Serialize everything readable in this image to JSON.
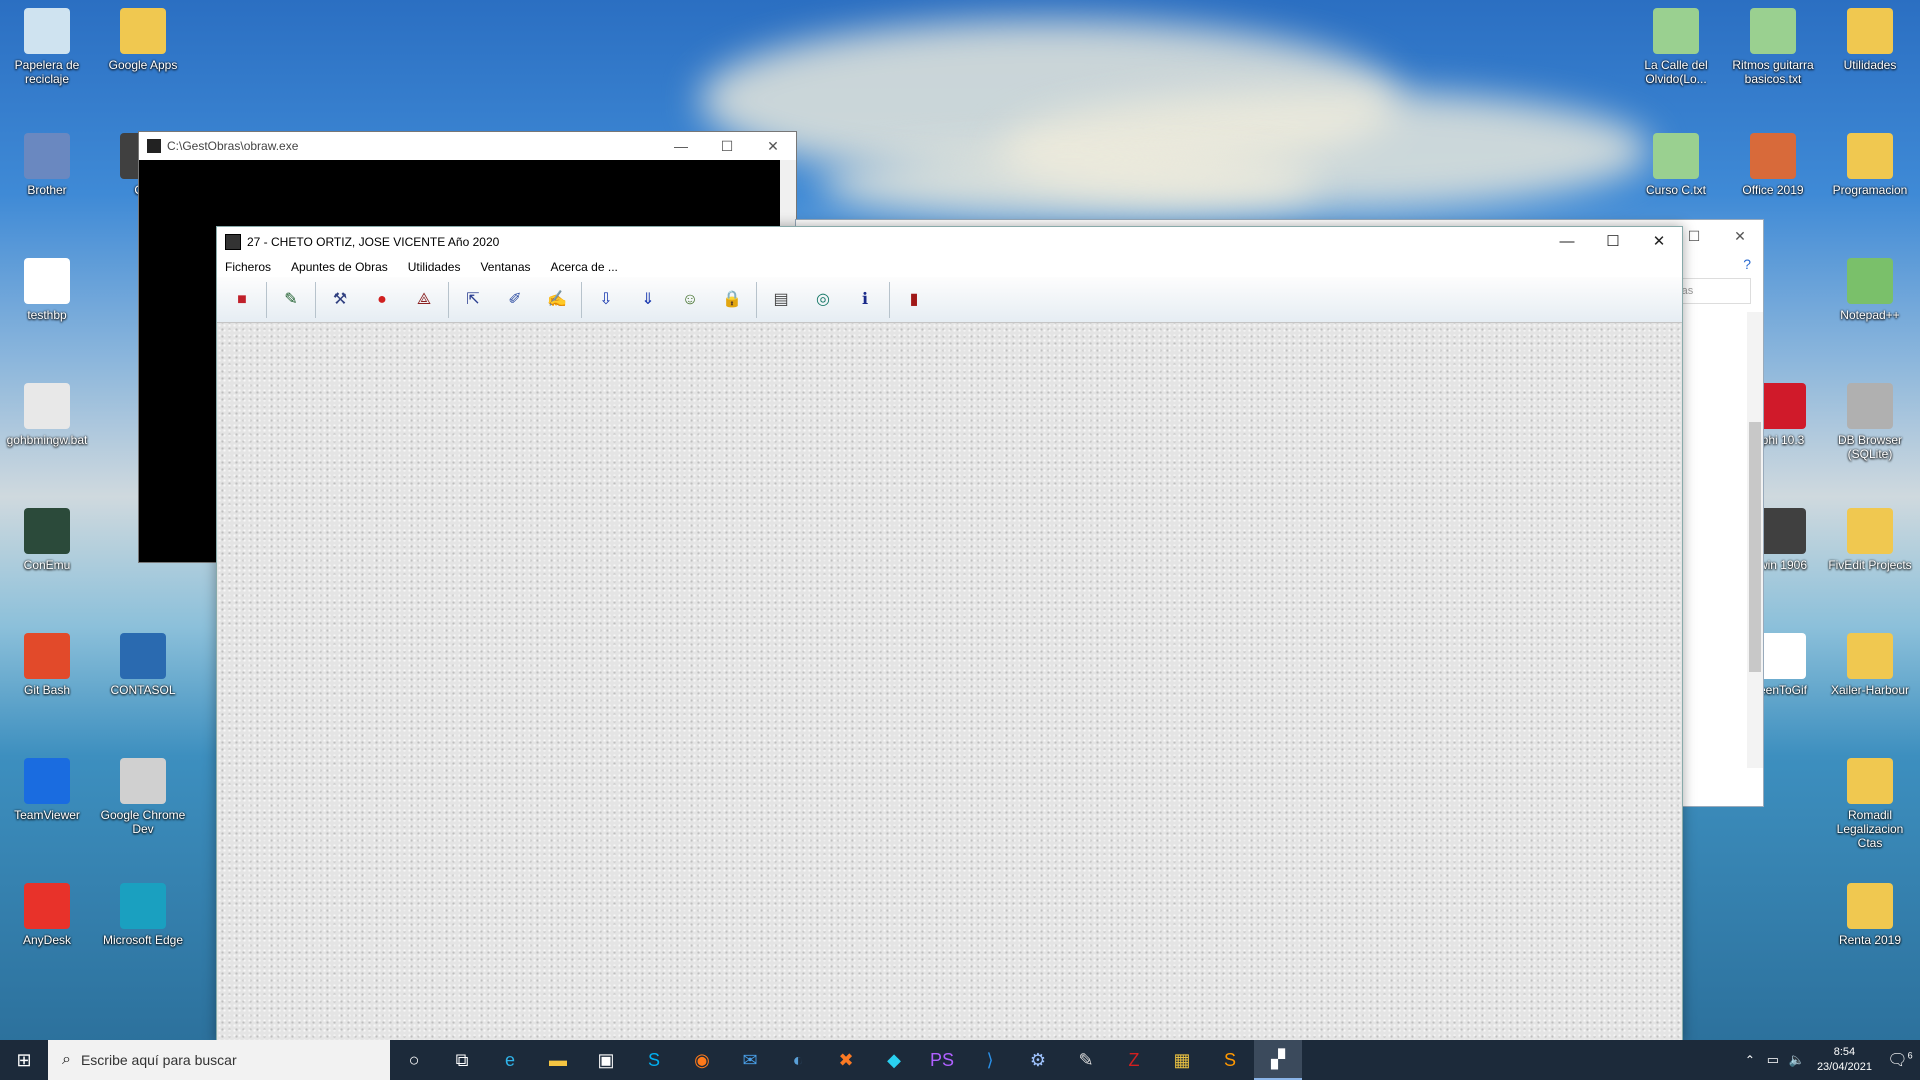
{
  "desktop": {
    "icons_left": [
      {
        "label": "Papelera de reciclaje",
        "icon": "recycle-bin-icon"
      },
      {
        "label": "Google Apps",
        "icon": "folder-icon"
      },
      {
        "label": "Brother",
        "icon": "printer-icon"
      },
      {
        "label": "OB",
        "icon": "app-icon"
      },
      {
        "label": "testhbp",
        "icon": "file-icon"
      },
      {
        "label": "gohbmingw.bat",
        "icon": "gear-file-icon"
      },
      {
        "label": "ConEmu",
        "icon": "conemu-icon"
      },
      {
        "label": "Git Bash",
        "icon": "git-icon"
      },
      {
        "label": "CONTASOL",
        "icon": "contasol-icon"
      },
      {
        "label": "TeamViewer",
        "icon": "teamviewer-icon"
      },
      {
        "label": "Google Chrome Dev",
        "icon": "chrome-dev-icon"
      },
      {
        "label": "AnyDesk",
        "icon": "anydesk-icon"
      },
      {
        "label": "Microsoft Edge",
        "icon": "edge-icon"
      }
    ],
    "icons_right": [
      {
        "label": "La Calle del Olvido(Lo...",
        "icon": "notepadpp-file-icon"
      },
      {
        "label": "Ritmos guitarra basicos.txt",
        "icon": "notepadpp-file-icon"
      },
      {
        "label": "Utilidades",
        "icon": "folder-icon"
      },
      {
        "label": "Curso C.txt",
        "icon": "notepadpp-file-icon"
      },
      {
        "label": "Office 2019",
        "icon": "office-folder-icon"
      },
      {
        "label": "Programacion",
        "icon": "folder-icon"
      },
      {
        "label": "Notepad++",
        "icon": "notepadpp-icon"
      },
      {
        "label": "phi 10.3",
        "icon": "delphi-icon"
      },
      {
        "label": "DB Browser (SQLite)",
        "icon": "database-icon"
      },
      {
        "label": "win 1906",
        "icon": "app-icon"
      },
      {
        "label": "FivEdit Projects",
        "icon": "folder-icon"
      },
      {
        "label": "eenToGif",
        "icon": "screentogif-icon"
      },
      {
        "label": "Xailer-Harbour",
        "icon": "folder-icon"
      },
      {
        "label": "Romadil Legalizacion Ctas",
        "icon": "folder-icon"
      },
      {
        "label": "Renta 2019",
        "icon": "folder-icon"
      }
    ]
  },
  "console_window": {
    "title": "C:\\GestObras\\obraw.exe"
  },
  "explorer_window": {
    "search_placeholder": "ras"
  },
  "main_window": {
    "title": "27 - CHETO ORTIZ, JOSE VICENTE Año 2020",
    "menu": [
      "Ficheros",
      "Apuntes de Obras",
      "Utilidades",
      "Ventanas",
      "Acerca de ..."
    ],
    "toolbar": [
      {
        "icon": "briefcase-icon",
        "color": "#c0202a",
        "glyph": "■"
      },
      {
        "sep": true
      },
      {
        "icon": "chart-edit-icon",
        "color": "#1a5c2a",
        "glyph": "✎"
      },
      {
        "sep": true
      },
      {
        "icon": "tools-icon",
        "color": "#304080",
        "glyph": "⚒"
      },
      {
        "icon": "palette-icon",
        "color": "#d02020",
        "glyph": "●"
      },
      {
        "icon": "compass-icon",
        "color": "#8a2020",
        "glyph": "⟁"
      },
      {
        "sep": true
      },
      {
        "icon": "export-icon",
        "color": "#2a3e90",
        "glyph": "⇱"
      },
      {
        "icon": "notebook-edit-icon",
        "color": "#2a4aa0",
        "glyph": "✐"
      },
      {
        "icon": "report-icon",
        "color": "#7a5a20",
        "glyph": "✍"
      },
      {
        "sep": true
      },
      {
        "icon": "document-download-icon",
        "color": "#1a3ab0",
        "glyph": "⇩"
      },
      {
        "icon": "save-icon",
        "color": "#1a3ab0",
        "glyph": "⇓"
      },
      {
        "icon": "users-icon",
        "color": "#3a6a20",
        "glyph": "☺"
      },
      {
        "icon": "lock-icon",
        "color": "#333333",
        "glyph": "🔒"
      },
      {
        "sep": true
      },
      {
        "icon": "calculator-icon",
        "color": "#444444",
        "glyph": "▤"
      },
      {
        "icon": "globe-icon",
        "color": "#1a7a6a",
        "glyph": "◎"
      },
      {
        "icon": "info-icon",
        "color": "#1a2a8a",
        "glyph": "ℹ"
      },
      {
        "sep": true
      },
      {
        "icon": "exit-door-icon",
        "color": "#a01818",
        "glyph": "▮"
      }
    ]
  },
  "taskbar": {
    "search_placeholder": "Escribe aquí para buscar",
    "apps": [
      {
        "icon": "cortana-icon",
        "glyph": "○"
      },
      {
        "icon": "task-view-icon",
        "glyph": "⧉"
      },
      {
        "icon": "edge-icon",
        "glyph": "e",
        "color": "#2fb3e8"
      },
      {
        "icon": "file-explorer-icon",
        "glyph": "▬",
        "color": "#f5c542"
      },
      {
        "icon": "store-icon",
        "glyph": "▣",
        "color": "#ffffff"
      },
      {
        "icon": "skype-icon",
        "glyph": "S",
        "color": "#00aff0"
      },
      {
        "icon": "firefox-icon",
        "glyph": "◉",
        "color": "#ff7a1a"
      },
      {
        "icon": "mail-icon",
        "glyph": "✉",
        "color": "#4aa0e8"
      },
      {
        "icon": "mysql-workbench-icon",
        "glyph": "◐",
        "color": "#5aa0d8"
      },
      {
        "icon": "xampp-icon",
        "glyph": "✖",
        "color": "#fb7a24"
      },
      {
        "icon": "generic-app-icon",
        "glyph": "◆",
        "color": "#2ad0f0"
      },
      {
        "icon": "phpstorm-icon",
        "glyph": "PS",
        "color": "#b060ff"
      },
      {
        "icon": "vscode-icon",
        "glyph": "⟩",
        "color": "#2a90e8"
      },
      {
        "icon": "settings-icon",
        "glyph": "⚙",
        "color": "#a0c4ff"
      },
      {
        "icon": "app-tool-icon",
        "glyph": "✎",
        "color": "#dddddd"
      },
      {
        "icon": "filezilla-icon",
        "glyph": "Z",
        "color": "#d02020"
      },
      {
        "icon": "grid-app-icon",
        "glyph": "▦",
        "color": "#e8c040"
      },
      {
        "icon": "sublime-icon",
        "glyph": "S",
        "color": "#ff9800"
      },
      {
        "icon": "gestobras-icon",
        "glyph": "▞",
        "color": "#ffffff",
        "active": true
      }
    ],
    "time": "8:54",
    "date": "23/04/2021",
    "notifications": "6"
  }
}
